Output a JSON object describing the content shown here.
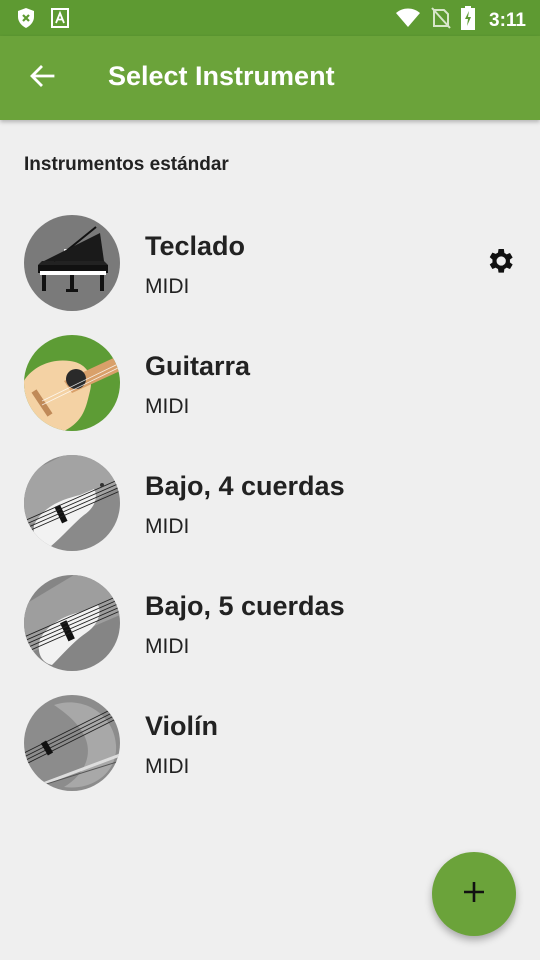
{
  "status_bar": {
    "time": "3:11",
    "icons": [
      "shield-x-icon",
      "font-a-icon",
      "wifi-icon",
      "no-sim-icon",
      "battery-charging-icon"
    ]
  },
  "app_bar": {
    "title": "Select Instrument",
    "back_icon": "arrow-left-icon"
  },
  "section": {
    "header": "Instrumentos estándar"
  },
  "instruments": [
    {
      "name": "Teclado",
      "type": "MIDI",
      "image": "grand-piano",
      "settings_icon": "gear-icon"
    },
    {
      "name": "Guitarra",
      "type": "MIDI",
      "image": "acoustic-guitar"
    },
    {
      "name": "Bajo, 4 cuerdas",
      "type": "MIDI",
      "image": "bass-guitar"
    },
    {
      "name": "Bajo, 5 cuerdas",
      "type": "MIDI",
      "image": "bass-guitar"
    },
    {
      "name": "Violín",
      "type": "MIDI",
      "image": "violin"
    }
  ],
  "fab": {
    "icon": "plus-icon"
  },
  "colors": {
    "primary": "#6ba33a",
    "primary_dark": "#5e9a32",
    "background": "#efefef"
  }
}
